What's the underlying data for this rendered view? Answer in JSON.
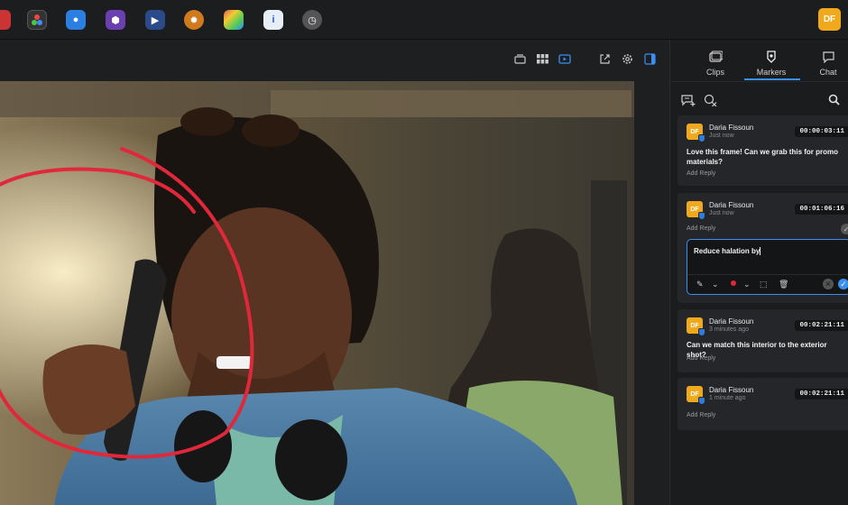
{
  "colors": {
    "accent": "#3a8ff0",
    "avatar": "#f0a81c",
    "annotation_stroke": "#e0283a"
  },
  "topbar": {
    "user_initials": "DF",
    "dock_icons": [
      "app-icon",
      "davinci-resolve-icon",
      "finder-icon",
      "cube-app-icon",
      "media-player-icon",
      "settings-wheel-icon",
      "color-grid-icon",
      "info-icon",
      "clock-icon"
    ]
  },
  "viewer_toolbar": {
    "icons": [
      "layout-icon",
      "grid-view-icon",
      "video-view-icon",
      "share-icon",
      "settings-icon",
      "panel-toggle-icon"
    ]
  },
  "panel": {
    "tabs": [
      {
        "label": "Clips",
        "icon": "clips-icon"
      },
      {
        "label": "Markers",
        "icon": "markers-icon"
      },
      {
        "label": "Chat",
        "icon": "chat-icon"
      }
    ],
    "active_tab": "Markers",
    "tools": [
      "add-comment-icon",
      "clear-markers-icon",
      "search-icon"
    ]
  },
  "comments": [
    {
      "author": "Daria Fissoun",
      "initials": "DF",
      "time": "Just now",
      "timecode": "00:00:03:11",
      "text": "Love this frame! Can we grab this for promo materials?",
      "reply": "Add Reply",
      "has_drawing": false
    },
    {
      "author": "Daria Fissoun",
      "initials": "DF",
      "time": "Just now",
      "timecode": "00:01:06:16",
      "text": "",
      "reply": "Add Reply",
      "has_drawing": true
    },
    {
      "author": "Daria Fissoun",
      "initials": "DF",
      "time": "3 minutes ago",
      "timecode": "00:02:21:11",
      "text": "Can we match this interior to the exterior shot?",
      "reply": "Add Reply",
      "has_drawing": false
    },
    {
      "author": "Daria Fissoun",
      "initials": "DF",
      "time": "1 minute ago",
      "timecode": "00:02:21:11",
      "text": "",
      "reply": "Add Reply",
      "has_drawing": true
    }
  ],
  "editor": {
    "value": "Reduce halation by"
  }
}
